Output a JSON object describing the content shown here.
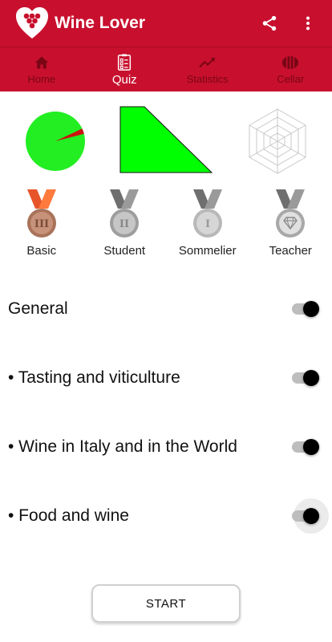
{
  "app": {
    "title": "Wine Lover"
  },
  "actions": {
    "share": "share-icon",
    "menu": "more-vert-icon"
  },
  "tabs": [
    {
      "label": "Home",
      "icon": "home-icon"
    },
    {
      "label": "Quiz",
      "icon": "quiz-icon",
      "active": true
    },
    {
      "label": "Statistics",
      "icon": "trending-up-icon"
    },
    {
      "label": "Cellar",
      "icon": "barrel-icon"
    }
  ],
  "stats": {
    "pie": {
      "correct_fraction": 0.97,
      "wrong_fraction": 0.03
    },
    "progress": {
      "level_fraction": 1.0
    }
  },
  "medals": [
    {
      "label": "Basic",
      "numeral": "III",
      "achieved": true
    },
    {
      "label": "Student",
      "numeral": "II",
      "achieved": false
    },
    {
      "label": "Sommelier",
      "numeral": "I",
      "achieved": false
    },
    {
      "label": "Teacher",
      "numeral": "diamond",
      "achieved": false
    }
  ],
  "categories": [
    {
      "label": "General",
      "enabled": true
    },
    {
      "label": "• Tasting and viticulture",
      "enabled": true
    },
    {
      "label": "• Wine in Italy and in the World",
      "enabled": true
    },
    {
      "label": "• Food and wine",
      "enabled": true
    }
  ],
  "start_button": "START",
  "colors": {
    "primary": "#c8102e",
    "correct": "#22ee22",
    "wrong": "#cc1111",
    "bronze": "#c0866a",
    "silver": "#9e9e9e"
  }
}
